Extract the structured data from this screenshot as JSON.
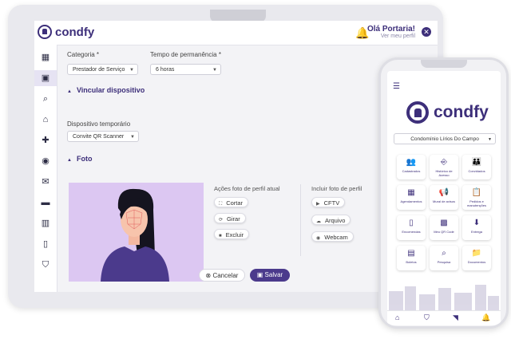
{
  "app": {
    "brand": "condfy",
    "greeting": "Olá Portaria!",
    "profile_link": "Ver meu perfil"
  },
  "form": {
    "category_label": "Categoria *",
    "category_value": "Prestador de Serviço",
    "stay_label": "Tempo de permanência *",
    "stay_value": "6 horas",
    "link_device_section": "Vincular dispositivo",
    "temp_device_label": "Dispositivo temporário",
    "temp_device_value": "Convite QR Scanner",
    "photo_section": "Foto"
  },
  "photo_actions": {
    "current_title": "Ações foto de perfil atual",
    "crop": "Cortar",
    "rotate": "Girar",
    "delete": "Excluir",
    "include_title": "Incluir foto de perfil",
    "cftv": "CFTV",
    "file": "Arquivo",
    "webcam": "Webcam"
  },
  "buttons": {
    "cancel": "Cancelar",
    "save": "Salvar"
  },
  "phone": {
    "brand": "condfy",
    "condo": "Condomínio Lírios Do Campo",
    "tiles": [
      {
        "label": "Cadastrados",
        "icon": "people-icon"
      },
      {
        "label": "Histórico de Acesso",
        "icon": "door-icon"
      },
      {
        "label": "Convidados",
        "icon": "guests-icon"
      },
      {
        "label": "Agendamentos",
        "icon": "calendar-icon"
      },
      {
        "label": "Mural de avisos",
        "icon": "megaphone-icon"
      },
      {
        "label": "Pedidos e manutenções",
        "icon": "clipboard-icon"
      },
      {
        "label": "Encomendas",
        "icon": "package-icon"
      },
      {
        "label": "Meu QR Code",
        "icon": "qrcode-icon"
      },
      {
        "label": "Entrega",
        "icon": "delivery-icon"
      },
      {
        "label": "Boletos",
        "icon": "bill-icon"
      },
      {
        "label": "Pesquisa",
        "icon": "search-icon"
      },
      {
        "label": "Documentos",
        "icon": "folder-icon"
      }
    ]
  },
  "colors": {
    "brand": "#3d2f7a",
    "save": "#4b3a8c",
    "photo_bg": "#dcc7f2"
  }
}
